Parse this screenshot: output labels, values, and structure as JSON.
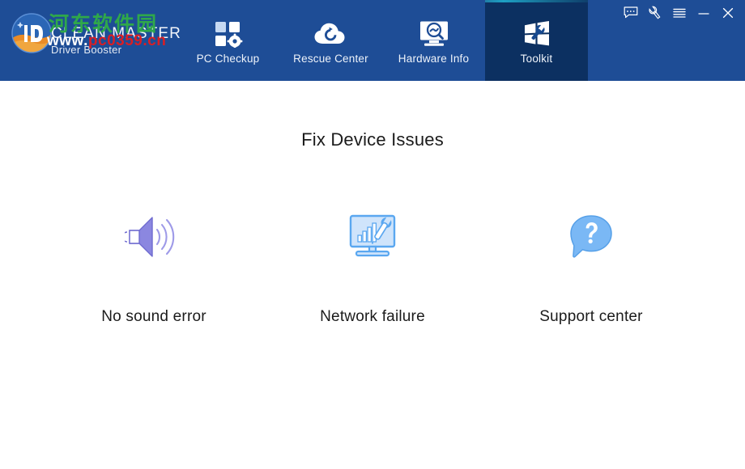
{
  "window": {
    "brand_title": "CLEAN MASTER",
    "brand_subtitle": "Driver Booster",
    "logo_icon": "driver-booster-logo-icon",
    "watermark_cn": "河东软件园",
    "watermark_url_prefix": "www.",
    "watermark_url_domain": "pc0359.cn",
    "colors": {
      "header_bg": "#1e4d96",
      "active_tab_bg": "#0c3061",
      "active_tab_accent": "#1ea0c4",
      "body_bg": "#ffffff",
      "title_text": "#1b1b1b",
      "watermark_green": "#2fa84a",
      "watermark_red": "#d81f25"
    },
    "controls": [
      {
        "name": "feedback-button",
        "icon": "speech-bubble-icon",
        "title": "Feedback"
      },
      {
        "name": "tools-button",
        "icon": "wrench-icon",
        "title": "Tools"
      },
      {
        "name": "menu-button",
        "icon": "hamburger-menu-icon",
        "title": "Menu"
      },
      {
        "name": "minimize-button",
        "icon": "minimize-icon",
        "title": "Minimize"
      },
      {
        "name": "close-button",
        "icon": "close-icon",
        "title": "Close"
      }
    ]
  },
  "nav": {
    "tabs": [
      {
        "label": "PC Checkup",
        "icon": "squares-gear-icon",
        "active": false
      },
      {
        "label": "Rescue Center",
        "icon": "cloud-refresh-icon",
        "active": false
      },
      {
        "label": "Hardware Info",
        "icon": "monitor-magnifier-icon",
        "active": false
      },
      {
        "label": "Toolkit",
        "icon": "windows-wrench-icon",
        "active": true
      }
    ]
  },
  "main": {
    "title": "Fix Device Issues",
    "features": [
      {
        "label": "No sound error",
        "icon": "speaker-sound-icon",
        "color": "#8b87e0"
      },
      {
        "label": "Network failure",
        "icon": "monitor-chart-wrench-icon",
        "color": "#5aa7f0"
      },
      {
        "label": "Support center",
        "icon": "question-bubble-icon",
        "color": "#7ab8f5"
      }
    ]
  }
}
